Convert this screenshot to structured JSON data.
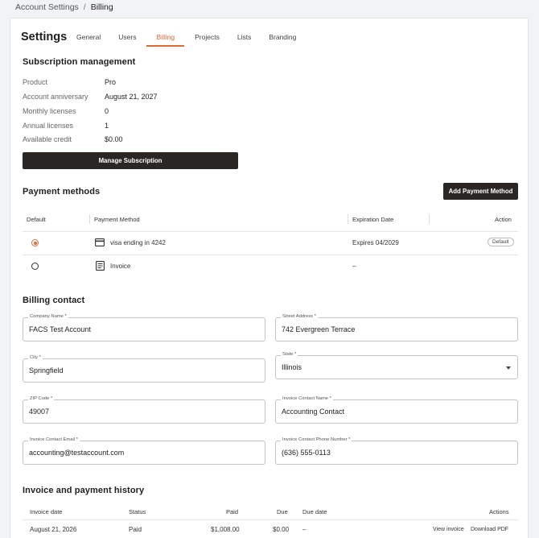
{
  "breadcrumb": {
    "parent": "Account Settings",
    "separator": "/",
    "current": "Billing"
  },
  "header": {
    "title": "Settings",
    "tabs": [
      "General",
      "Users",
      "Billing",
      "Projects",
      "Lists",
      "Branding"
    ],
    "active_tab": "Billing"
  },
  "subscription": {
    "heading": "Subscription management",
    "rows": [
      {
        "label": "Product",
        "value": "Pro"
      },
      {
        "label": "Account anniversary",
        "value": "August 21, 2027"
      },
      {
        "label": "Monthly licenses",
        "value": "0"
      },
      {
        "label": "Annual licenses",
        "value": "1"
      },
      {
        "label": "Available credit",
        "value": "$0.00"
      }
    ],
    "manage_label": "Manage Subscription"
  },
  "payment_methods": {
    "heading": "Payment methods",
    "add_label": "Add Payment Method",
    "columns": [
      "Default",
      "Payment Method",
      "Expiration Date",
      "Action"
    ],
    "rows": [
      {
        "default": true,
        "icon": "credit-card-icon",
        "method": "visa ending in 4242",
        "expiration": "Expires 04/2029",
        "action": "Default"
      },
      {
        "default": false,
        "icon": "invoice-icon",
        "method": "Invoice",
        "expiration": "–",
        "action": ""
      }
    ]
  },
  "billing_contact": {
    "heading": "Billing contact",
    "fields": {
      "company": {
        "label": "Company Name *",
        "value": "FACS Test Account"
      },
      "street": {
        "label": "Street Address *",
        "value": "742 Evergreen Terrace"
      },
      "city": {
        "label": "City *",
        "value": "Springfield"
      },
      "state": {
        "label": "State *",
        "value": "Illinois"
      },
      "zip": {
        "label": "ZIP Code *",
        "value": "49007"
      },
      "contact_name": {
        "label": "Invoice Contact Name *",
        "value": "Accounting Contact"
      },
      "contact_email": {
        "label": "Invoice Contact Email *",
        "value": "accounting@testaccount.com"
      },
      "contact_phone": {
        "label": "Invoice Contact Phone Number *",
        "value": "(636) 555-0113"
      }
    }
  },
  "history": {
    "heading": "Invoice and payment history",
    "columns": [
      "Invoice date",
      "Status",
      "Paid",
      "Due",
      "Due date",
      "Actions"
    ],
    "rows": [
      {
        "date": "August 21, 2026",
        "status": "Paid",
        "paid": "$1,008.00",
        "due": "$0.00",
        "due_date": "–",
        "view": "View invoice",
        "download": "Download PDF"
      }
    ]
  },
  "colors": {
    "accent": "#d96c34",
    "dark_button": "#2a2623",
    "page_bg": "#f2f3f5"
  }
}
